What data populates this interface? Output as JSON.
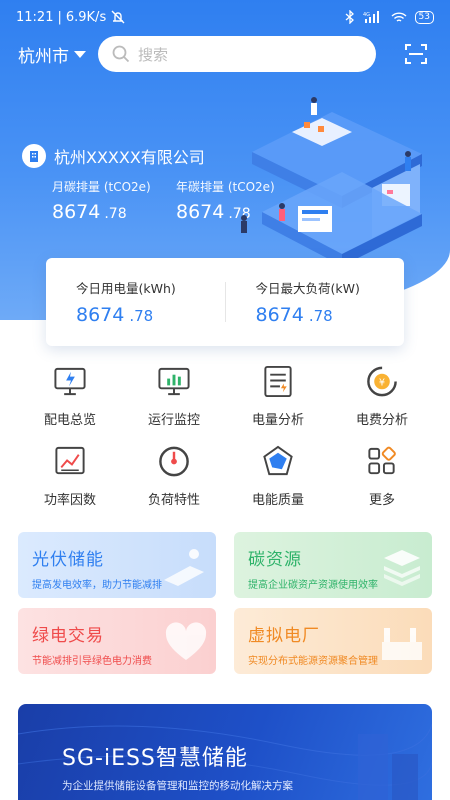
{
  "status_bar": {
    "time": "11:21",
    "speed": "6.9K/s",
    "signal": "4G",
    "battery": "53"
  },
  "header": {
    "city": "杭州市",
    "search_placeholder": "搜索"
  },
  "company": {
    "name": "杭州XXXXX有限公司",
    "monthly_label": "月碳排量 (tCO2e)",
    "monthly_int": "8674",
    "monthly_dec": ".78",
    "yearly_label": "年碳排量 (tCO2e)",
    "yearly_int": "8674",
    "yearly_dec": ".78"
  },
  "today": {
    "power_label": "今日用电量(kWh)",
    "power_int": "8674",
    "power_dec": ".78",
    "load_label": "今日最大负荷(kW)",
    "load_int": "8674",
    "load_dec": ".78"
  },
  "menu": [
    {
      "label": "配电总览",
      "icon": "monitor-bolt-icon"
    },
    {
      "label": "运行监控",
      "icon": "monitor-chart-icon"
    },
    {
      "label": "电量分析",
      "icon": "document-list-icon"
    },
    {
      "label": "电费分析",
      "icon": "yuan-gauge-icon"
    },
    {
      "label": "功率因数",
      "icon": "line-chart-icon"
    },
    {
      "label": "负荷特性",
      "icon": "gauge-icon"
    },
    {
      "label": "电能质量",
      "icon": "radar-icon"
    },
    {
      "label": "更多",
      "icon": "grid-more-icon"
    }
  ],
  "tiles": [
    {
      "title": "光伏储能",
      "subtitle": "提高发电效率，助力节能减排",
      "icon": "solar-panel-icon"
    },
    {
      "title": "碳资源",
      "subtitle": "提高企业碳资产资源使用效率",
      "icon": "layers-icon"
    },
    {
      "title": "绿电交易",
      "subtitle": "节能减排引导绿色电力消费",
      "icon": "handshake-icon"
    },
    {
      "title": "虚拟电厂",
      "subtitle": "实现分布式能源资源聚合管理",
      "icon": "factory-icon"
    }
  ],
  "banner": {
    "title": "SG-iESS智慧储能",
    "subtitle": "为企业提供储能设备管理和监控的移动化解决方案"
  },
  "colors": {
    "primary": "#2f7ff0",
    "green": "#2fb36a",
    "red": "#ef4b4b",
    "orange": "#f08a24",
    "banner": "#1e50c8"
  }
}
